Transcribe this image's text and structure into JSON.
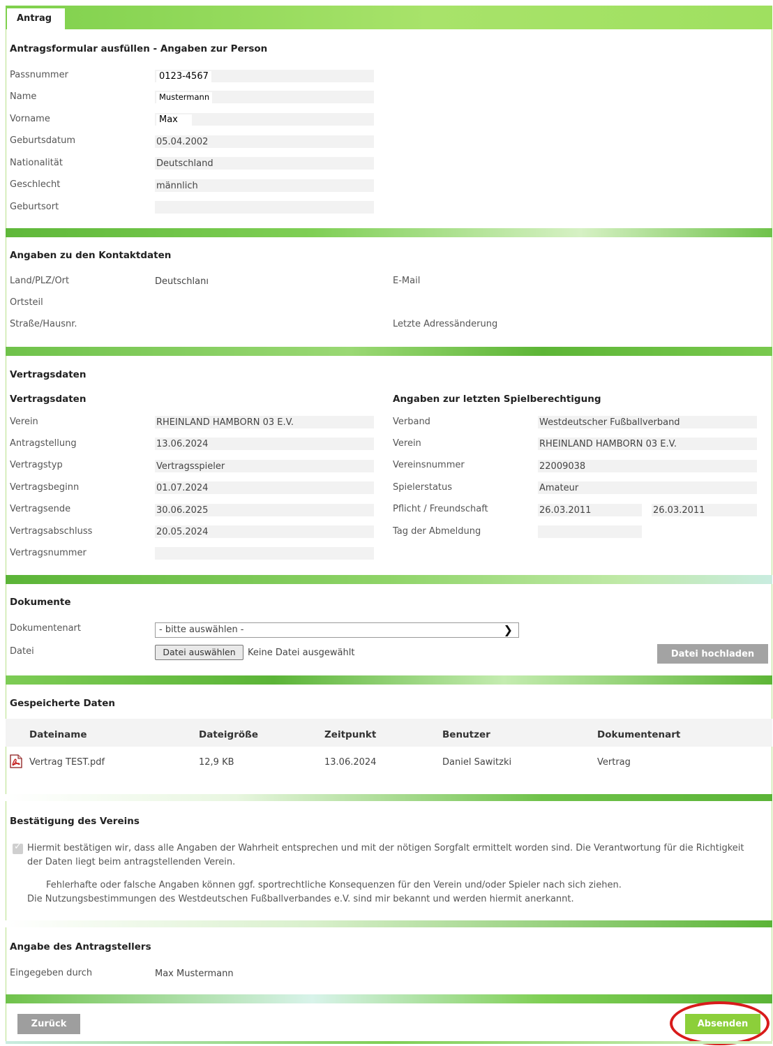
{
  "tab": {
    "label": "Antrag"
  },
  "person": {
    "heading": "Antragsformular ausfüllen - Angaben zur Person",
    "fields": [
      {
        "label": "Passnummer",
        "value": "0123-4567"
      },
      {
        "label": "Name",
        "value": "Mustermann"
      },
      {
        "label": "Vorname",
        "value": "Max"
      },
      {
        "label": "Geburtsdatum",
        "value": "05.04.2002"
      },
      {
        "label": "Nationalität",
        "value": "Deutschland"
      },
      {
        "label": "Geschlecht",
        "value": "männlich"
      },
      {
        "label": "Geburtsort",
        "value": ""
      }
    ]
  },
  "contact": {
    "heading": "Angaben zu den Kontaktdaten",
    "land_label": "Land/PLZ/Ort",
    "land_value": "Deutschlanı",
    "ortsteil_label": "Ortsteil",
    "strasse_label": "Straße/Hausnr.",
    "email_label": "E-Mail",
    "adress_label": "Letzte Adressänderung"
  },
  "contract": {
    "heading": "Vertragsdaten",
    "subheading": "Vertragsdaten",
    "fields": [
      {
        "label": "Verein",
        "value": "RHEINLAND HAMBORN 03 E.V."
      },
      {
        "label": "Antragstellung",
        "value": "13.06.2024"
      },
      {
        "label": "Vertragstyp",
        "value": "Vertragsspieler"
      },
      {
        "label": "Vertragsbeginn",
        "value": "01.07.2024"
      },
      {
        "label": "Vertragsende",
        "value": "30.06.2025"
      },
      {
        "label": "Vertragsabschluss",
        "value": "20.05.2024"
      },
      {
        "label": "Vertragsnummer",
        "value": ""
      }
    ]
  },
  "eligibility": {
    "heading": "Angaben zur letzten Spielberechtigung",
    "fields": [
      {
        "label": "Verband",
        "value": "Westdeutscher Fußballverband"
      },
      {
        "label": "Verein",
        "value": "RHEINLAND HAMBORN 03 E.V."
      },
      {
        "label": "Vereinsnummer",
        "value": "22009038"
      },
      {
        "label": "Spielerstatus",
        "value": "Amateur"
      },
      {
        "label": "Pflicht / Freundschaft",
        "value": "26.03.2011",
        "value2": "26.03.2011"
      },
      {
        "label": "Tag der Abmeldung",
        "value": ""
      }
    ]
  },
  "documents": {
    "heading": "Dokumente",
    "type_label": "Dokumentenart",
    "type_selected": "- bitte auswählen -",
    "file_label": "Datei",
    "file_button": "Datei auswählen",
    "file_status": "Keine Datei ausgewählt",
    "upload_button": "Datei hochladen"
  },
  "saved": {
    "heading": "Gespeicherte Daten",
    "columns": [
      "Dateiname",
      "Dateigröße",
      "Zeitpunkt",
      "Benutzer",
      "Dokumentenart"
    ],
    "rows": [
      {
        "name": "Vertrag TEST.pdf",
        "size": "12,9 KB",
        "time": "13.06.2024",
        "user": "Daniel Sawitzki",
        "type": "Vertrag"
      }
    ],
    "file_icon": "pdf-icon"
  },
  "confirmation": {
    "heading": "Bestätigung des Vereins",
    "checked": true,
    "text1": "Hiermit bestätigen wir, dass alle Angaben der Wahrheit entsprechen und mit der nötigen Sorgfalt ermittelt worden sind. Die Verantwortung für die Richtigkeit der Daten liegt beim antragstellenden Verein.",
    "text2": "Fehlerhafte oder falsche Angaben können ggf. sportrechtliche Konsequenzen für den Verein und/oder Spieler nach sich ziehen.",
    "text3": "Die Nutzungsbestimmungen des Westdeutschen Fußballverbandes e.V. sind mir bekannt und werden hiermit anerkannt."
  },
  "applicant": {
    "heading": "Angabe des Antragstellers",
    "label": "Eingegeben durch",
    "value": "Max Mustermann"
  },
  "footer": {
    "back_button": "Zurück",
    "submit_button": "Absenden"
  },
  "colors": {
    "accent_green": "#8ccf3a",
    "button_gray": "#9e9e9e",
    "highlight_red": "#d81b1b"
  }
}
